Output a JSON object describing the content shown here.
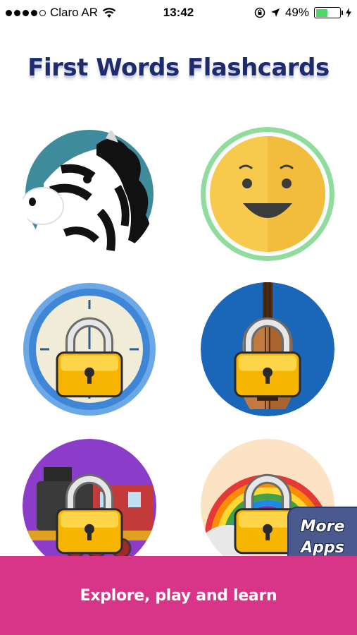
{
  "status_bar": {
    "carrier": "Claro AR",
    "time": "13:42",
    "battery": "49%",
    "battery_level": 0.49,
    "signal_bars": 4,
    "icons": [
      "signal-dots",
      "wifi-icon",
      "orientation-lock-icon",
      "location-arrow-icon",
      "battery-icon",
      "charging-bolt-icon"
    ]
  },
  "header": {
    "title": "First Words Flashcards"
  },
  "categories": [
    {
      "name": "animals",
      "icon": "zebra-icon",
      "locked": false,
      "ring_color": "#ffffff",
      "bg_color": "#3e8b9c"
    },
    {
      "name": "feelings",
      "icon": "smiley-face-icon",
      "locked": false,
      "ring_color": "#8fdc9c",
      "bg_color": "#f7c94c"
    },
    {
      "name": "time",
      "icon": "clock-icon",
      "locked": true,
      "ring_color": "#4c8fd8",
      "bg_color": "#f1ecd8"
    },
    {
      "name": "music",
      "icon": "guitar-icon",
      "locked": true,
      "ring_color": "#1a66b8",
      "bg_color": "#1a66b8"
    },
    {
      "name": "vehicles",
      "icon": "train-icon",
      "locked": true,
      "ring_color": "#8b3cc9",
      "bg_color": "#8b3cc9"
    },
    {
      "name": "weather",
      "icon": "rainbow-icon",
      "locked": true,
      "ring_color": "#fbe3c4",
      "bg_color": "#fbe3c4"
    }
  ],
  "more_apps": {
    "line1": "More",
    "line2": "Apps"
  },
  "footer": {
    "tagline": "Explore, play and learn"
  },
  "colors": {
    "footer": "#d83589",
    "title": "#1e2c6e",
    "more_apps": "#4a5a8e"
  }
}
